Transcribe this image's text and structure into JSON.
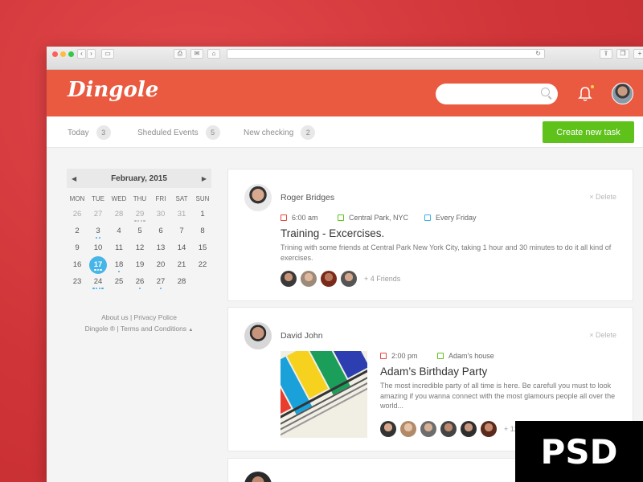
{
  "header": {
    "logo": "Dingole",
    "search_placeholder": ""
  },
  "tabs": [
    {
      "label": "Today",
      "count": "3"
    },
    {
      "label": "Sheduled Events",
      "count": "5"
    },
    {
      "label": "New checking",
      "count": "2"
    }
  ],
  "create_button": "Create new task",
  "calendar": {
    "month": "February, 2015",
    "prev_icon": "triangle-left",
    "next_icon": "triangle-right",
    "dow": [
      "MON",
      "TUE",
      "WED",
      "THU",
      "FRI",
      "SAT",
      "SUN"
    ],
    "weeks": [
      [
        "26",
        "27",
        "28",
        "29",
        "30",
        "31",
        "1"
      ],
      [
        "2",
        "3",
        "4",
        "5",
        "6",
        "7",
        "8"
      ],
      [
        "9",
        "10",
        "11",
        "12",
        "13",
        "14",
        "15"
      ],
      [
        "16",
        "17",
        "18",
        "19",
        "20",
        "21",
        "22"
      ],
      [
        "23",
        "24",
        "25",
        "26",
        "27",
        "28",
        ""
      ]
    ],
    "selected": "17"
  },
  "footer": {
    "line1": "About us | Privacy Police",
    "line2": "Dingole ®  | Terms and Conditions"
  },
  "events": [
    {
      "user": "Roger Bridges",
      "delete_label": "Delete",
      "time": "6:00 am",
      "location": "Central Park, NYC",
      "repeat": "Every Friday",
      "title": "Training - Excercises.",
      "description": "Trining with some friends at Central Park New York City, taking 1 hour and 30 minutes to do it all kind of exercises.",
      "friends_more": "+ 4 Friends"
    },
    {
      "user": "David John",
      "delete_label": "Delete",
      "time": "2:00 pm",
      "location": "Adam's house",
      "title": "Adam’s Birthday Party",
      "description": "The most incredible party of all time is here.  Be carefull you must to look amazing if you wanna connect with the most glamours people all over the world...",
      "friends_more": "+ 12"
    }
  ],
  "overlay_label": "PSD",
  "colors": {
    "header": "#e95a40",
    "accent_green": "#5ec21b",
    "accent_blue": "#47b5e8",
    "background": "#cf3438"
  }
}
